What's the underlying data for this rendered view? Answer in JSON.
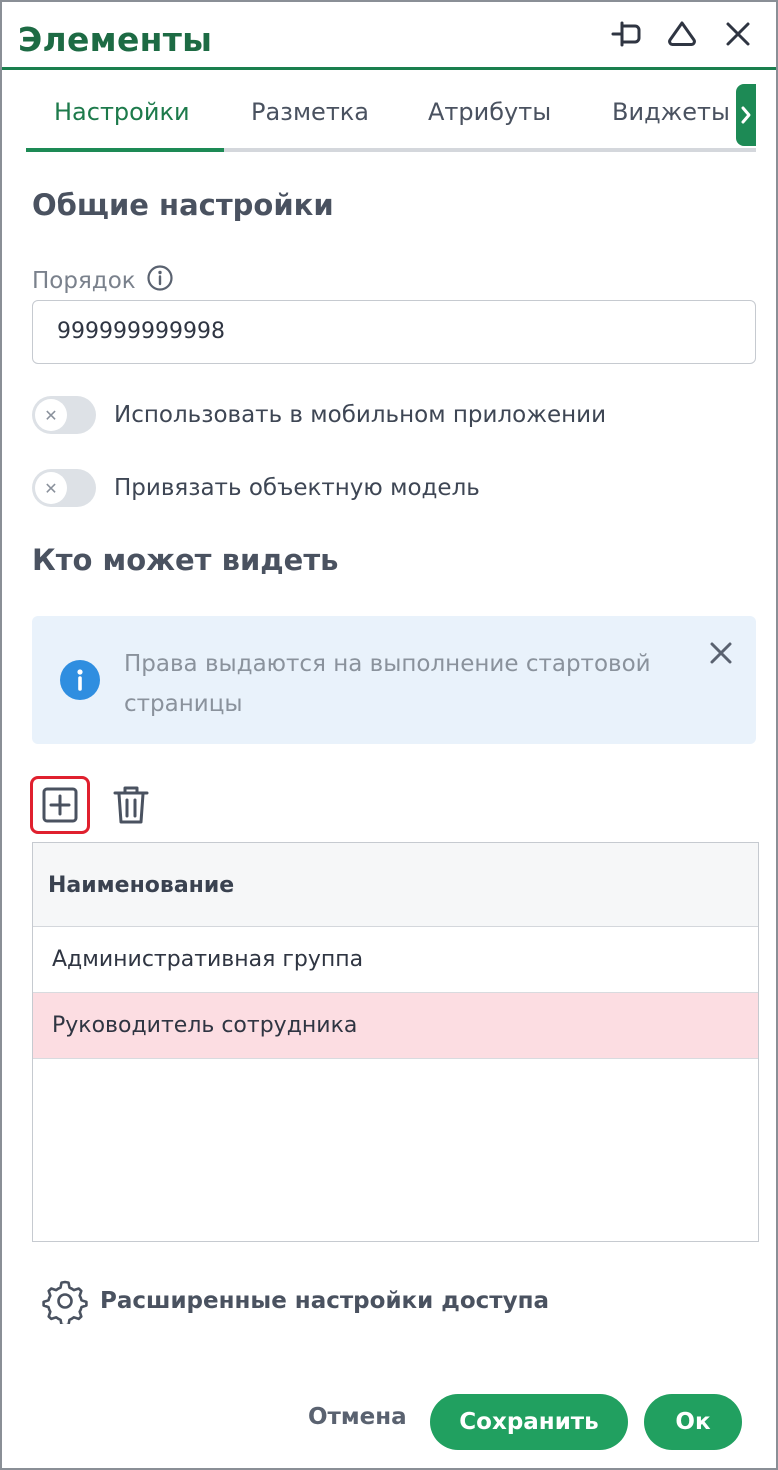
{
  "window": {
    "title": "Элементы",
    "icons": [
      "pin-icon",
      "collapse-icon",
      "close-icon"
    ]
  },
  "tabs": [
    {
      "label": "Настройки",
      "active": true
    },
    {
      "label": "Разметка",
      "active": false
    },
    {
      "label": "Атрибуты",
      "active": false
    },
    {
      "label": "Виджеты",
      "active": false
    }
  ],
  "general": {
    "title": "Общие настройки",
    "order_label": "Порядок",
    "order_value": "999999999998",
    "toggles": [
      {
        "label": "Использовать в мобильном приложении",
        "on": false
      },
      {
        "label": "Привязать объектную модель",
        "on": false
      }
    ]
  },
  "visibility": {
    "title": "Кто может видеть",
    "info_text": "Права выдаются на выполнение стартовой страницы",
    "table": {
      "header": "Наименование",
      "rows": [
        {
          "name": "Административная группа",
          "selected": false
        },
        {
          "name": "Руководитель сотрудника",
          "selected": true
        }
      ]
    },
    "advanced_label": "Расширенные настройки доступа"
  },
  "footer": {
    "cancel": "Отмена",
    "save": "Сохранить",
    "ok": "Ок"
  },
  "colors": {
    "accent": "#1d8a55",
    "title": "#1d6b44",
    "selected_row": "#fcdde2",
    "info_bg": "#e9f2fb",
    "highlight": "#e0202e"
  }
}
